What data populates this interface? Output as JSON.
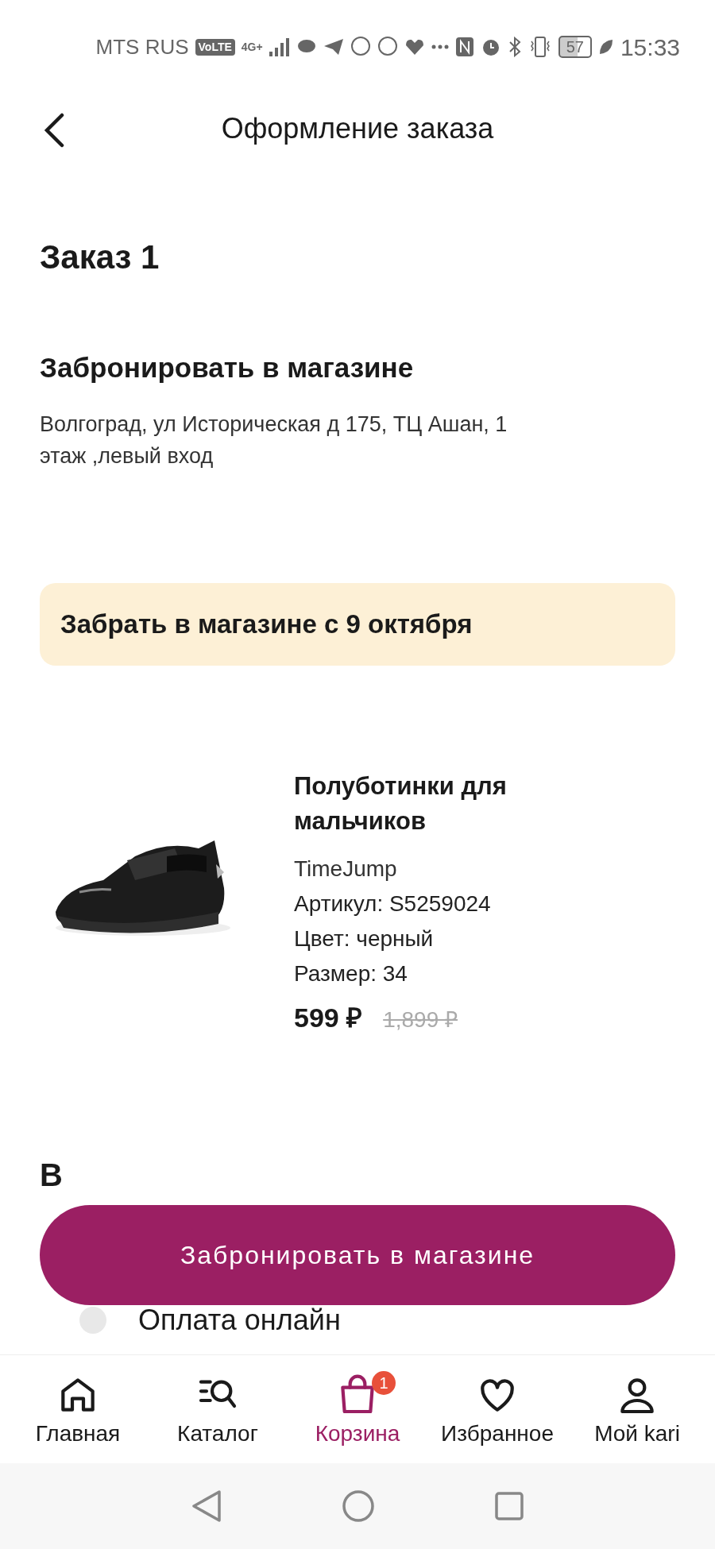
{
  "status_bar": {
    "carrier": "MTS RUS",
    "volte": "VoLTE",
    "network": "4G+",
    "battery": "57",
    "time": "15:33"
  },
  "header": {
    "title": "Оформление заказа"
  },
  "order": {
    "title": "Заказ 1",
    "delivery_title": "Забронировать в магазине",
    "address": "Волгоград, ул Историческая д 175, ТЦ Ашан, 1 этаж ,левый вход",
    "pickup_banner": "Забрать в магазине с 9 октября"
  },
  "product": {
    "name": "Полуботинки для мальчиков",
    "brand": "TimeJump",
    "details": [
      "Артикул: S5259024",
      "Цвет: черный",
      "Размер: 34"
    ],
    "price": "599 ₽",
    "old_price": "1,899 ₽"
  },
  "payment": {
    "title": "В",
    "options": [
      {
        "label": "Оплата онлайн",
        "selected": false
      }
    ]
  },
  "primary_button": "Забронировать в магазине",
  "bottom_nav": [
    {
      "label": "Главная",
      "selected": false
    },
    {
      "label": "Каталог",
      "selected": false
    },
    {
      "label": "Корзина",
      "selected": true,
      "badge": "1"
    },
    {
      "label": "Избранное",
      "selected": false
    },
    {
      "label": "Мой kari",
      "selected": false
    }
  ]
}
